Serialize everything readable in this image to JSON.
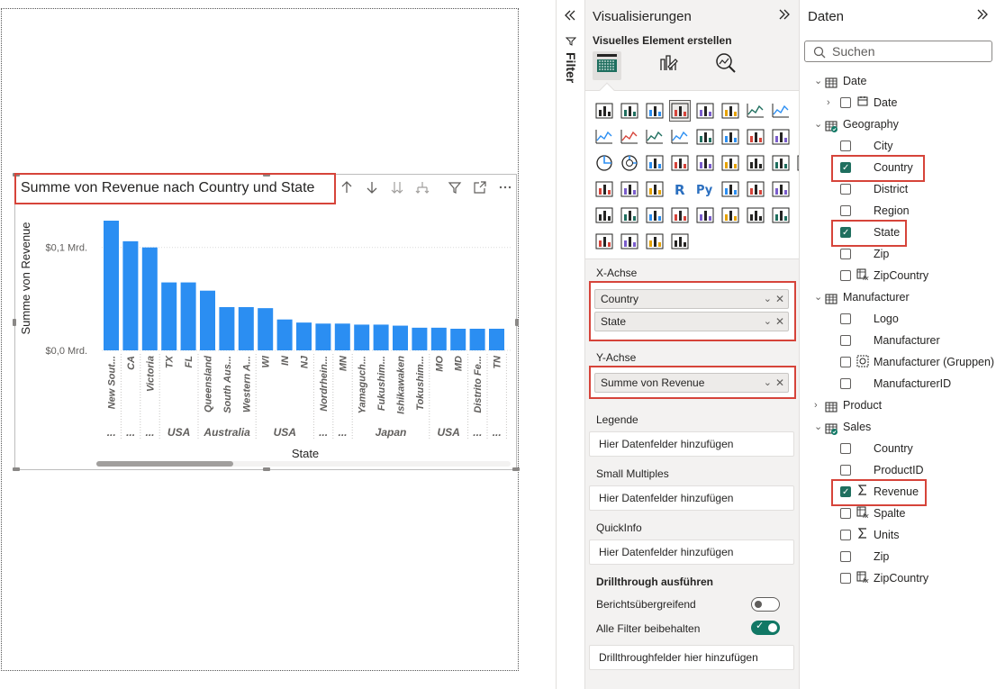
{
  "filters": {
    "label": "Filter"
  },
  "visual": {
    "title": "Summe von Revenue nach Country und State",
    "header_icons": [
      "drill-up-icon",
      "drill-down-icon",
      "expand-next-level-icon",
      "expand-hierarchy-icon",
      "filter-icon",
      "focus-mode-icon",
      "more-options-icon"
    ]
  },
  "chart_data": {
    "type": "bar",
    "title": "Summe von Revenue nach Country und State",
    "xlabel": "State",
    "ylabel": "Summe von Revenue",
    "ytick_labels": [
      "$0,0 Mrd.",
      "$0,1 Mrd."
    ],
    "ylim": [
      0,
      0.14
    ],
    "grid": true,
    "legend": "none",
    "categories": [
      "New Sout...",
      "CA",
      "Victoria",
      "TX",
      "FL",
      "Queensland",
      "South Aus...",
      "Western A...",
      "WI",
      "IN",
      "NJ",
      "Nordrhein...",
      "MN",
      "Yamaguch...",
      "Fukushim...",
      "Ishikawaken",
      "Tokushim...",
      "MO",
      "MD",
      "Distrito Fe...",
      "TN"
    ],
    "values": [
      0.126,
      0.106,
      0.1,
      0.066,
      0.066,
      0.058,
      0.042,
      0.042,
      0.041,
      0.03,
      0.027,
      0.026,
      0.026,
      0.025,
      0.025,
      0.024,
      0.022,
      0.022,
      0.021,
      0.021,
      0.021
    ],
    "country_groups": [
      {
        "label": "...",
        "span": 1
      },
      {
        "label": "...",
        "span": 1
      },
      {
        "label": "...",
        "span": 1
      },
      {
        "label": "USA",
        "span": 2
      },
      {
        "label": "Australia",
        "span": 3
      },
      {
        "label": "USA",
        "span": 3
      },
      {
        "label": "...",
        "span": 1
      },
      {
        "label": "...",
        "span": 1
      },
      {
        "label": "Japan",
        "span": 4
      },
      {
        "label": "USA",
        "span": 2
      },
      {
        "label": "...",
        "span": 1
      },
      {
        "label": "...",
        "span": 1
      }
    ],
    "colors": {
      "bar": "#2b8ef2"
    }
  },
  "viz_pane": {
    "title": "Visualisierungen",
    "subtitle": "Visuelles Element erstellen",
    "tabs": [
      "build-visual-icon",
      "format-visual-icon",
      "analytics-icon"
    ],
    "x_axis": {
      "label": "X-Achse",
      "fields": [
        "Country",
        "State"
      ]
    },
    "y_axis": {
      "label": "Y-Achse",
      "fields": [
        "Summe von Revenue"
      ]
    },
    "legend": {
      "label": "Legende",
      "placeholder": "Hier Datenfelder hinzufügen"
    },
    "small_multiples": {
      "label": "Small Multiples",
      "placeholder": "Hier Datenfelder hinzufügen"
    },
    "tooltips": {
      "label": "QuickInfo",
      "placeholder": "Hier Datenfelder hinzufügen"
    },
    "drillthrough": {
      "label": "Drillthrough ausführen",
      "cross_report": {
        "label": "Berichtsübergreifend",
        "on": false
      },
      "keep_filters": {
        "label": "Alle Filter beibehalten",
        "on": true
      },
      "placeholder": "Drillthroughfelder hier hinzufügen"
    },
    "colors": {
      "accent": "#117865",
      "highlight": "#d6443a"
    }
  },
  "data_pane": {
    "title": "Daten",
    "search_placeholder": "Suchen",
    "tables": [
      {
        "name": "Date",
        "expanded": true,
        "fields": [
          {
            "name": "Date",
            "icon": "calendar-icon",
            "checked": false,
            "expandable": true
          }
        ]
      },
      {
        "name": "Geography",
        "expanded": true,
        "fields": [
          {
            "name": "City",
            "checked": false
          },
          {
            "name": "Country",
            "checked": true
          },
          {
            "name": "District",
            "checked": false
          },
          {
            "name": "Region",
            "checked": false
          },
          {
            "name": "State",
            "checked": true
          },
          {
            "name": "Zip",
            "checked": false
          },
          {
            "name": "ZipCountry",
            "icon": "calculated-column-icon",
            "checked": false
          }
        ]
      },
      {
        "name": "Manufacturer",
        "expanded": true,
        "fields": [
          {
            "name": "Logo",
            "checked": false
          },
          {
            "name": "Manufacturer",
            "checked": false
          },
          {
            "name": "Manufacturer (Gruppen)",
            "icon": "group-icon",
            "checked": false
          },
          {
            "name": "ManufacturerID",
            "checked": false
          }
        ]
      },
      {
        "name": "Product",
        "expanded": false,
        "fields": []
      },
      {
        "name": "Sales",
        "expanded": true,
        "fields": [
          {
            "name": "Country",
            "checked": false
          },
          {
            "name": "ProductID",
            "checked": false
          },
          {
            "name": "Revenue",
            "icon": "sum-icon",
            "checked": true
          },
          {
            "name": "Spalte",
            "icon": "calculated-column-icon",
            "checked": false
          },
          {
            "name": "Units",
            "icon": "sum-icon",
            "checked": false
          },
          {
            "name": "Zip",
            "checked": false
          },
          {
            "name": "ZipCountry",
            "icon": "calculated-column-icon",
            "checked": false
          }
        ]
      }
    ]
  }
}
